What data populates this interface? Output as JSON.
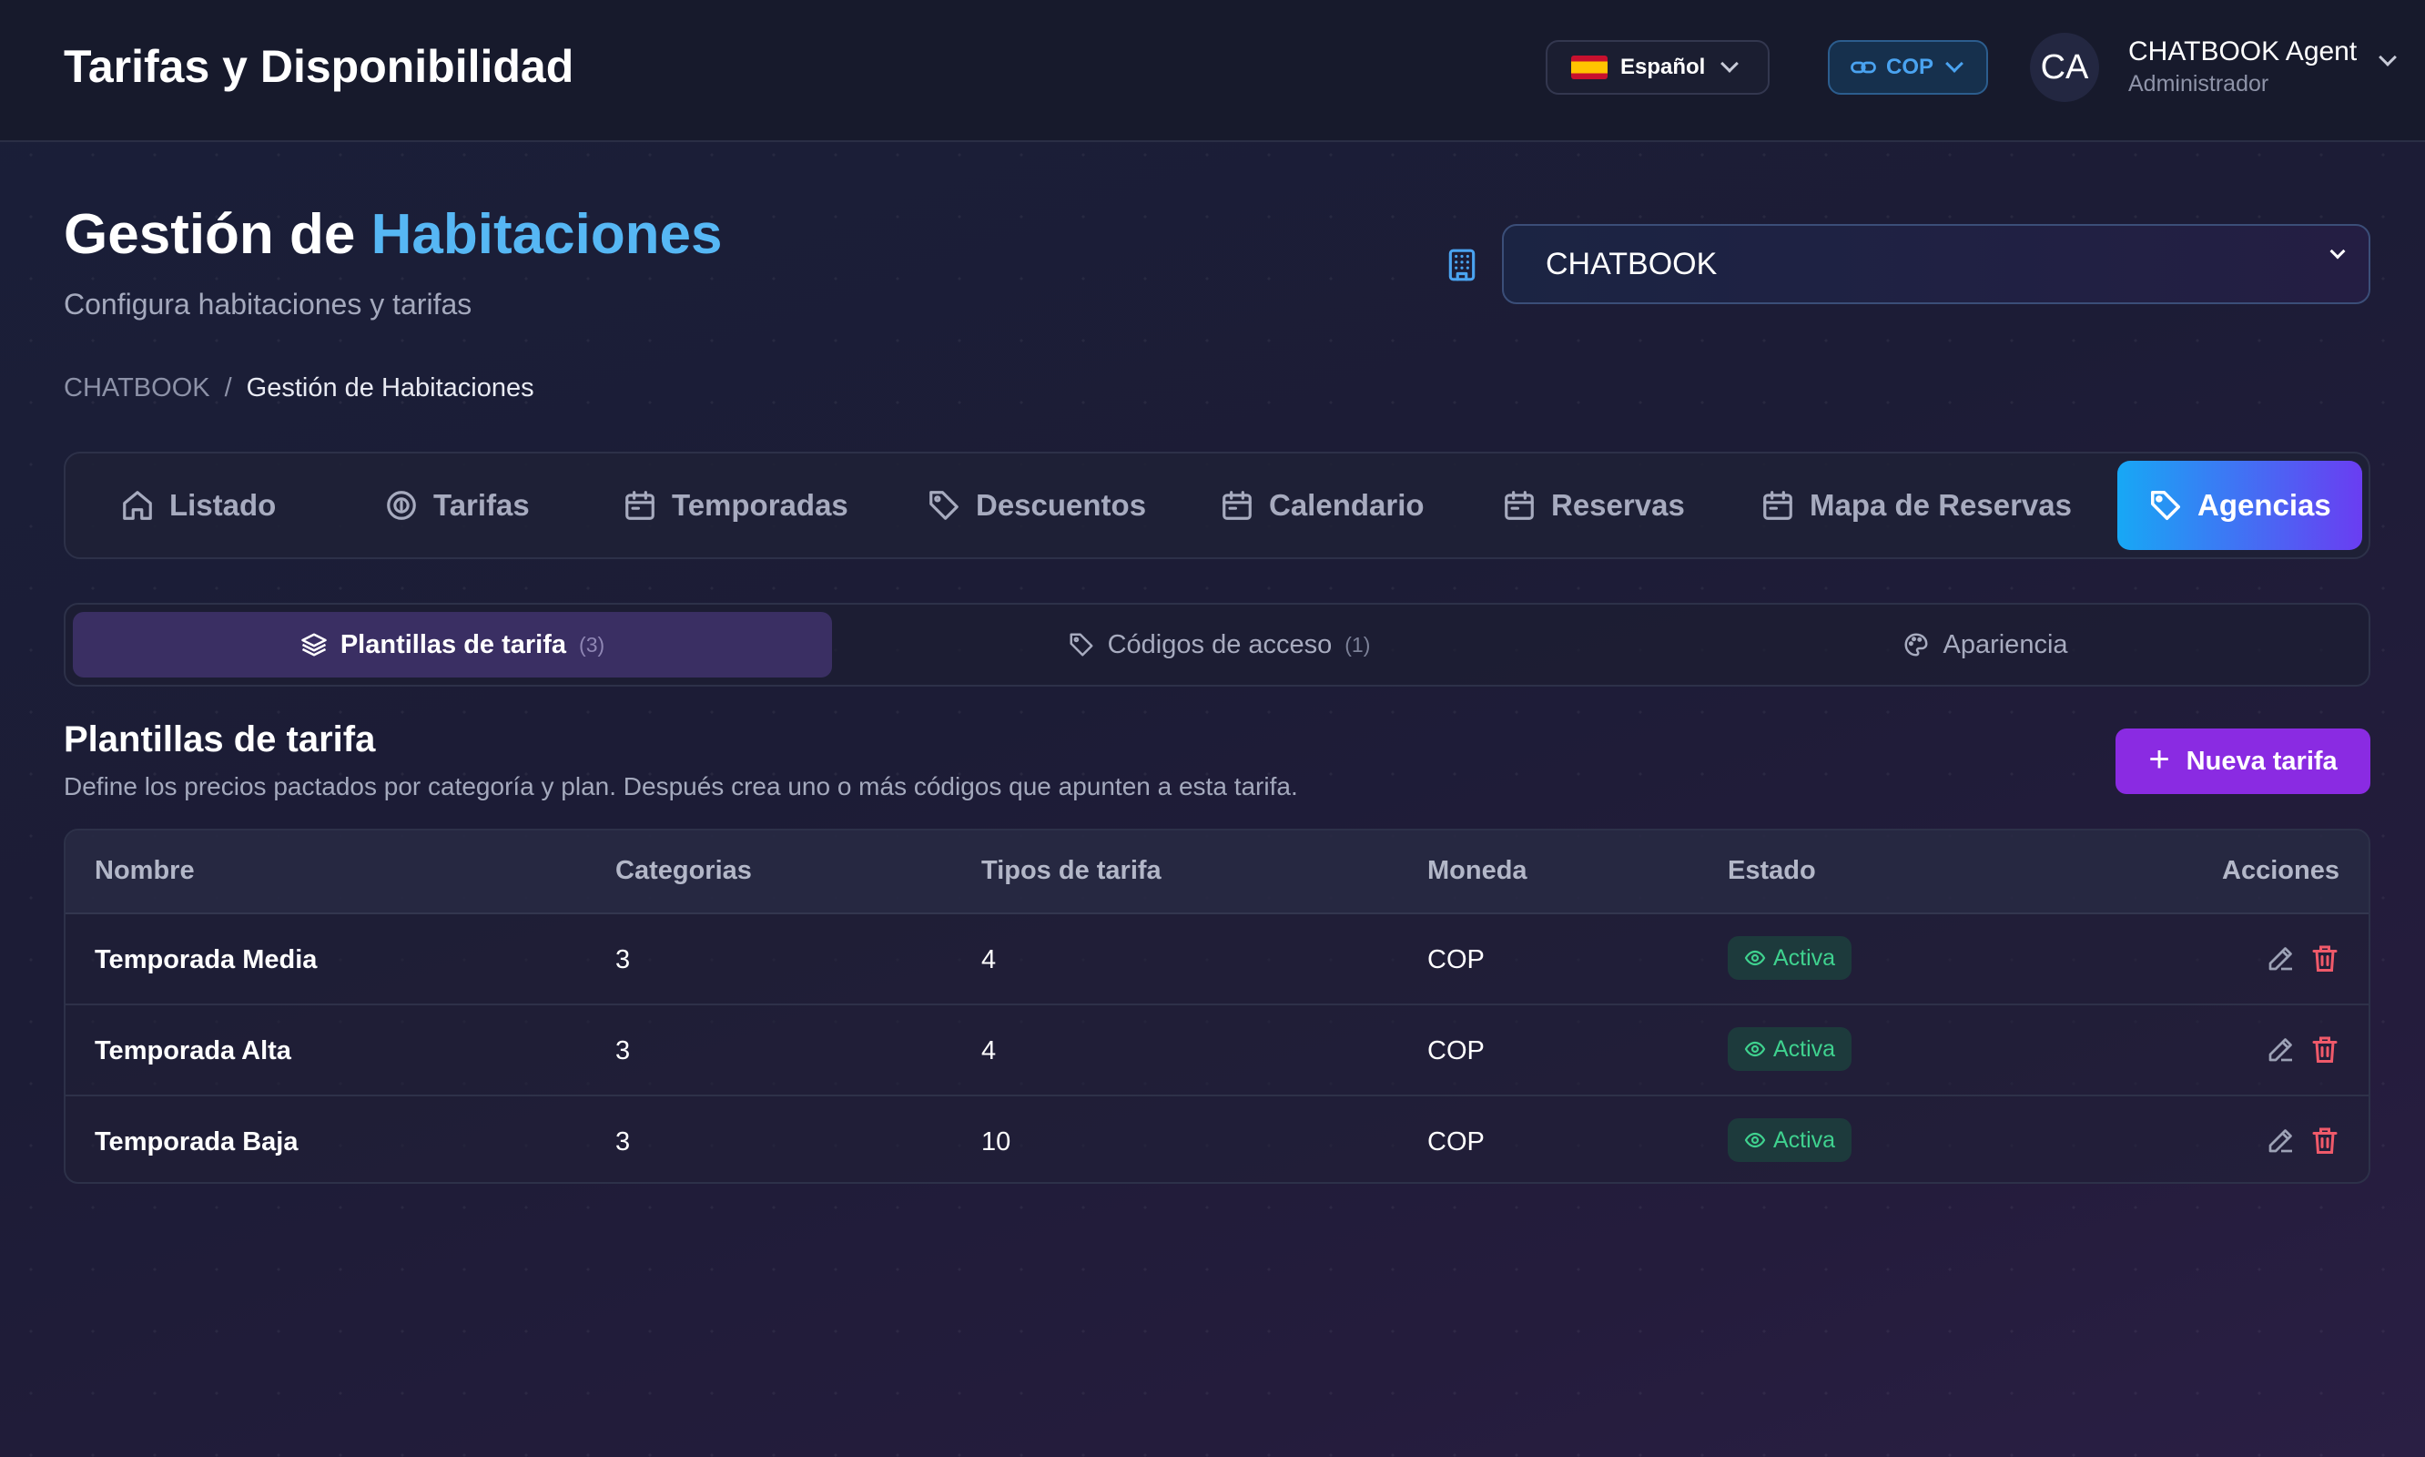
{
  "header": {
    "app_title": "Tarifas y Disponibilidad",
    "language": "Español",
    "currency": "COP",
    "user_initials": "CA",
    "user_name": "CHATBOOK Agent",
    "user_role": "Administrador"
  },
  "page": {
    "title_part1": "Gestión de",
    "title_part2": "Habitaciones",
    "subtitle": "Configura habitaciones y tarifas",
    "breadcrumb": [
      "CHATBOOK",
      "/",
      "Gestión de Habitaciones"
    ],
    "hotel_selected": "CHATBOOK"
  },
  "main_tabs": [
    {
      "label": "Listado",
      "icon": "home-icon"
    },
    {
      "label": "Tarifas",
      "icon": "coin-icon"
    },
    {
      "label": "Temporadas",
      "icon": "calendar-icon"
    },
    {
      "label": "Descuentos",
      "icon": "tag-icon"
    },
    {
      "label": "Calendario",
      "icon": "calendar-icon"
    },
    {
      "label": "Reservas",
      "icon": "calendar-icon"
    },
    {
      "label": "Mapa de Reservas",
      "icon": "calendar-icon"
    },
    {
      "label": "Agencias",
      "icon": "tag-icon",
      "active": true
    }
  ],
  "sub_tabs": [
    {
      "label": "Plantillas de tarifa",
      "count": "(3)",
      "icon": "layers-icon",
      "active": true
    },
    {
      "label": "Códigos de acceso",
      "count": "(1)",
      "icon": "tag-icon"
    },
    {
      "label": "Apariencia",
      "icon": "palette-icon"
    }
  ],
  "section": {
    "title": "Plantillas de tarifa",
    "description": "Define los precios pactados por categoría y plan. Después crea uno o más códigos que apunten a esta tarifa.",
    "new_button": "Nueva tarifa"
  },
  "table": {
    "columns": [
      "Nombre",
      "Categorias",
      "Tipos de tarifa",
      "Moneda",
      "Estado",
      "Acciones"
    ],
    "rows": [
      {
        "name": "Temporada Media",
        "categories": "3",
        "rate_types": "4",
        "currency": "COP",
        "status": "Activa"
      },
      {
        "name": "Temporada Alta",
        "categories": "3",
        "rate_types": "4",
        "currency": "COP",
        "status": "Activa"
      },
      {
        "name": "Temporada Baja",
        "categories": "3",
        "rate_types": "10",
        "currency": "COP",
        "status": "Activa"
      }
    ]
  },
  "colors": {
    "accent_blue": "#56b7f4",
    "primary_purple": "#8a2be2",
    "status_green": "#3fd28f",
    "delete_red": "#f05a6a"
  }
}
